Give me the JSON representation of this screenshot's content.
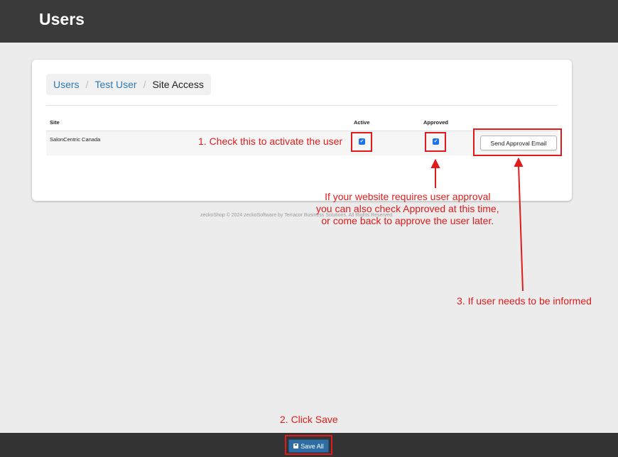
{
  "header": {
    "title": "Users"
  },
  "breadcrumb": {
    "items": [
      {
        "label": "Users"
      },
      {
        "label": "Test User"
      },
      {
        "label": "Site Access"
      }
    ],
    "separator": "/"
  },
  "table": {
    "columns": {
      "site": "Site",
      "active": "Active",
      "approved": "Approved"
    },
    "rows": [
      {
        "site": "SalonCentric Canada",
        "active": true,
        "approved": true,
        "action_label": "Send Approval Email"
      }
    ]
  },
  "footer": {
    "copyright": "zeckoShop © 2024 zeckoSoftware by Terracor Business Solutions. All Rights Reserved."
  },
  "bottom_bar": {
    "save_label": "Save All",
    "save_icon": "floppy-disk-icon"
  },
  "annotations": {
    "step1": "1. Check this to activate the user",
    "step2": "2. Click Save",
    "step3": "3. If user needs to be informed",
    "approval_note": [
      "If your website requires user approval",
      "you can also check Approved at this time,",
      "or come back to approve the user later."
    ]
  },
  "colors": {
    "header_bg": "#3a3a3a",
    "link": "#2a79b8",
    "annotation": "#e11b1b",
    "checkbox": "#1a73e8",
    "save_button": "#2e6da4"
  }
}
